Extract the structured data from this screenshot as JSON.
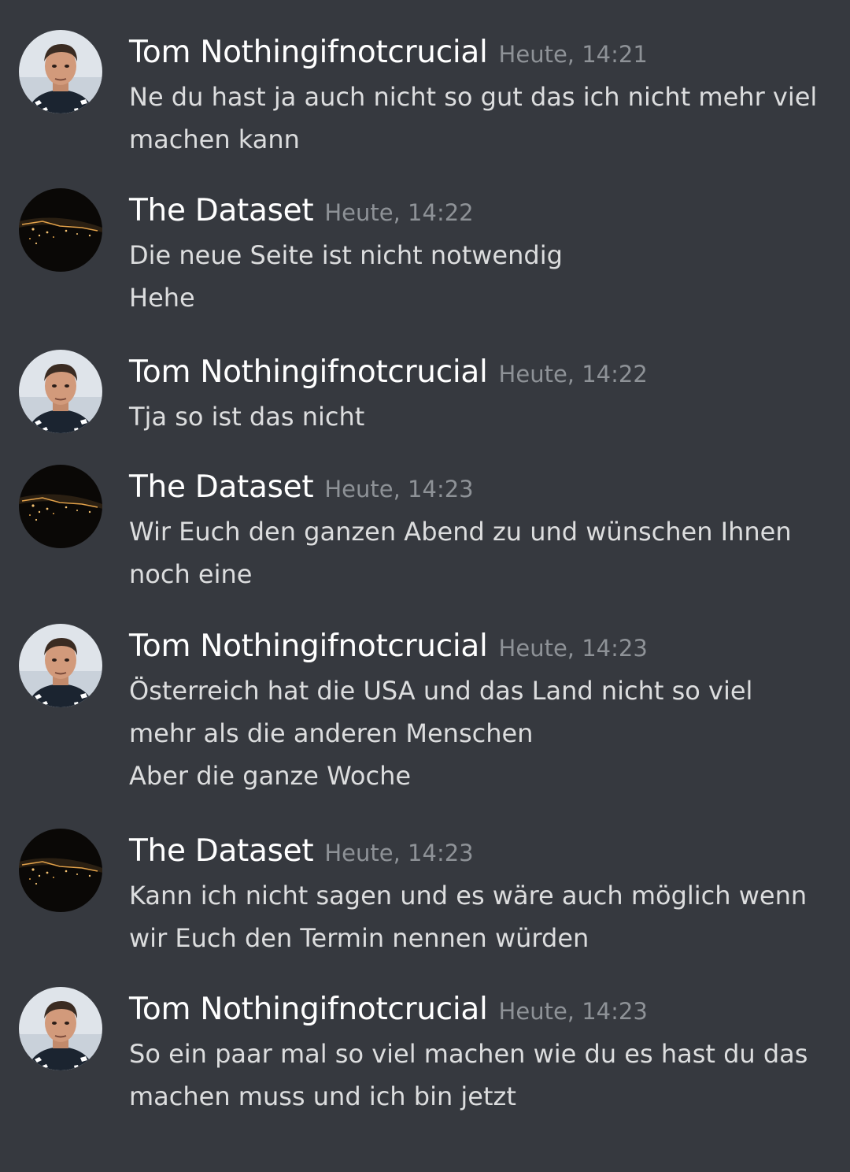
{
  "messages": [
    {
      "author": "Tom Nothingifnotcrucial",
      "avatar": "person-avatar",
      "timestamp": "Heute, 14:21",
      "lines": [
        "Ne du hast ja auch nicht so gut das ich nicht mehr viel",
        "machen kann"
      ]
    },
    {
      "author": "The Dataset",
      "avatar": "night-earth-avatar",
      "timestamp": "Heute, 14:22",
      "lines": [
        "Die neue Seite ist nicht notwendig",
        "Hehe"
      ]
    },
    {
      "author": "Tom Nothingifnotcrucial",
      "avatar": "person-avatar",
      "timestamp": "Heute, 14:22",
      "lines": [
        "Tja so ist das nicht"
      ]
    },
    {
      "author": "The Dataset",
      "avatar": "night-earth-avatar",
      "timestamp": "Heute, 14:23",
      "lines": [
        "Wir Euch den ganzen Abend zu und wünschen Ihnen",
        "noch eine"
      ]
    },
    {
      "author": "Tom Nothingifnotcrucial",
      "avatar": "person-avatar",
      "timestamp": "Heute, 14:23",
      "lines": [
        "Österreich hat die USA und das Land nicht so viel",
        "mehr als die anderen Menschen",
        "Aber die ganze Woche"
      ]
    },
    {
      "author": "The Dataset",
      "avatar": "night-earth-avatar",
      "timestamp": "Heute, 14:23",
      "lines": [
        "Kann ich nicht sagen und es wäre auch möglich wenn",
        "wir Euch den Termin nennen würden"
      ]
    },
    {
      "author": "Tom Nothingifnotcrucial",
      "avatar": "person-avatar",
      "timestamp": "Heute, 14:23",
      "lines": [
        "So ein paar mal so viel machen wie du es hast du das",
        "machen muss und ich bin jetzt"
      ]
    }
  ],
  "colors": {
    "background": "#36393f",
    "author": "#ffffff",
    "timestamp": "#8e9297",
    "text": "#dcddde"
  }
}
